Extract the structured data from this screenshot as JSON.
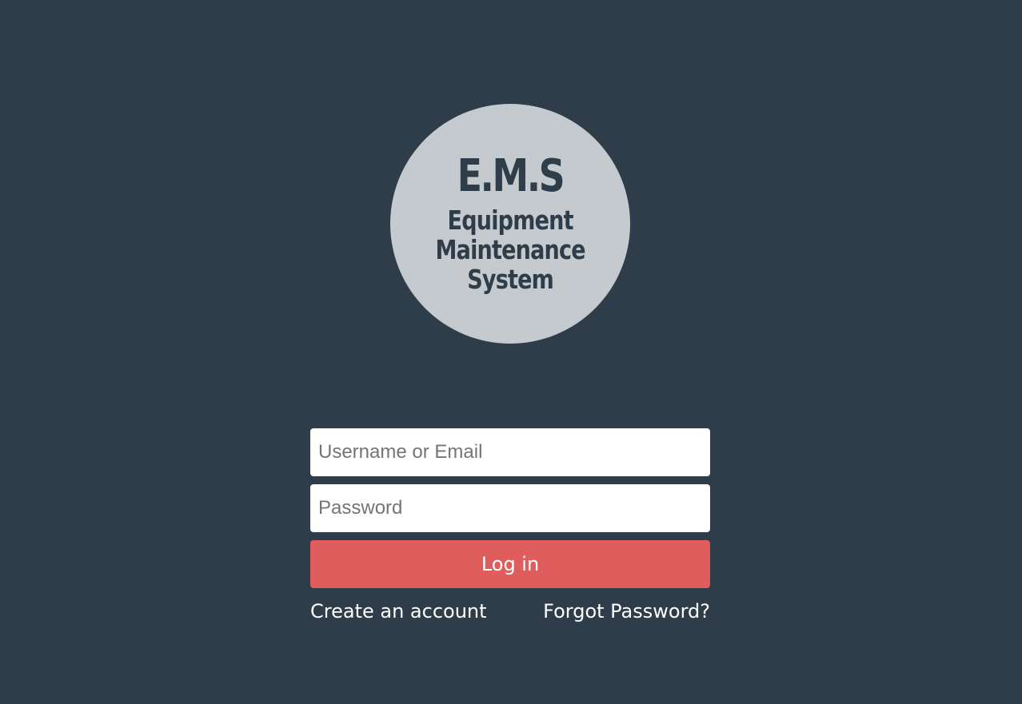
{
  "logo": {
    "abbreviation": "E.M.S",
    "name_lines": [
      "Equipment",
      "Maintenance",
      "System"
    ]
  },
  "login_form": {
    "username_placeholder": "Username or Email",
    "username_value": "",
    "password_placeholder": "Password",
    "password_value": "",
    "submit_label": "Log in"
  },
  "links": {
    "create_account": "Create an account",
    "forgot_password": "Forgot Password?"
  },
  "colors": {
    "background": "#2e3d49",
    "logo_circle": "#c5cacf",
    "logo_text": "#2e3d49",
    "login_button": "#e05d5d",
    "link_text": "#ffffff"
  }
}
